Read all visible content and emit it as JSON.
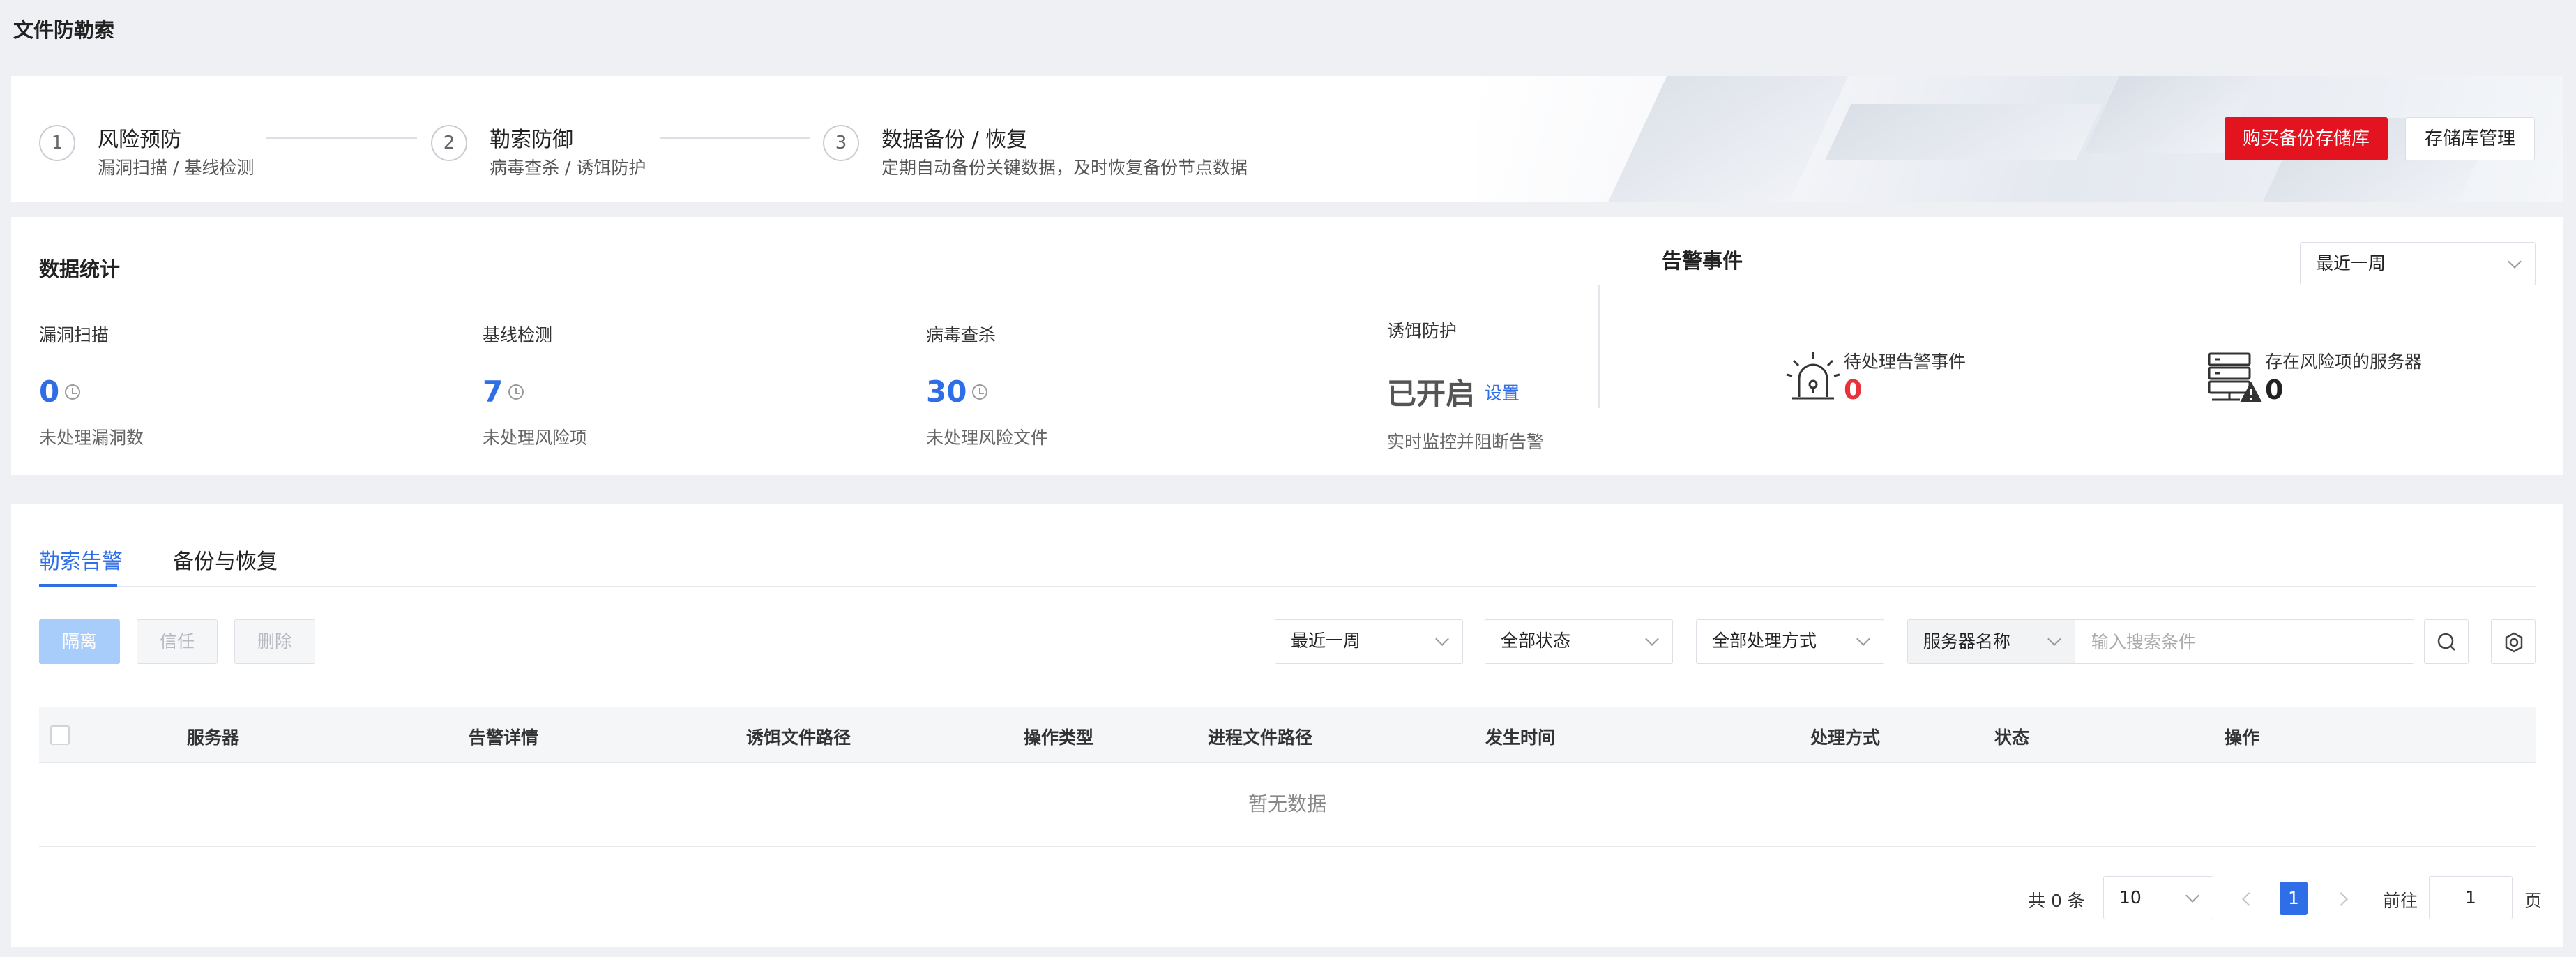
{
  "page": {
    "title": "文件防勒索"
  },
  "steps": [
    {
      "num": "1",
      "title": "风险预防",
      "sub": "漏洞扫描 / 基线检测"
    },
    {
      "num": "2",
      "title": "勒索防御",
      "sub": "病毒查杀 / 诱饵防护"
    },
    {
      "num": "3",
      "title": "数据备份 / 恢复",
      "sub": "定期自动备份关键数据，及时恢复备份节点数据"
    }
  ],
  "banner": {
    "buy_label": "购买备份存储库",
    "manage_label": "存储库管理"
  },
  "stats": {
    "title": "数据统计",
    "items": [
      {
        "label": "漏洞扫描",
        "value": "0",
        "sub": "未处理漏洞数"
      },
      {
        "label": "基线检测",
        "value": "7",
        "sub": "未处理风险项"
      },
      {
        "label": "病毒查杀",
        "value": "30",
        "sub": "未处理风险文件"
      }
    ],
    "bait": {
      "label": "诱饵防护",
      "status": "已开启",
      "link": "设置",
      "sub": "实时监控并阻断告警"
    }
  },
  "alerts": {
    "title": "告警事件",
    "range": "最近一周",
    "pending_label": "待处理告警事件",
    "pending_value": "0",
    "risk_servers_label": "存在风险项的服务器",
    "risk_servers_value": "0"
  },
  "tabs": [
    {
      "label": "勒索告警"
    },
    {
      "label": "备份与恢复"
    }
  ],
  "toolbar": {
    "isolate": "隔离",
    "trust": "信任",
    "delete": "删除",
    "range": "最近一周",
    "status": "全部状态",
    "method": "全部处理方式",
    "search_field": "服务器名称",
    "search_placeholder": "输入搜索条件"
  },
  "table": {
    "columns": [
      "服务器",
      "告警详情",
      "诱饵文件路径",
      "操作类型",
      "进程文件路径",
      "发生时间",
      "处理方式",
      "状态",
      "操作"
    ],
    "empty": "暂无数据"
  },
  "pagination": {
    "total": "共 0 条",
    "page_size": "10",
    "current": "1",
    "goto_label": "前往",
    "goto_value": "1",
    "page_unit": "页"
  },
  "colors": {
    "primary": "#2f6ee6",
    "danger": "#e3131f",
    "alert_value": "#e8323b"
  }
}
